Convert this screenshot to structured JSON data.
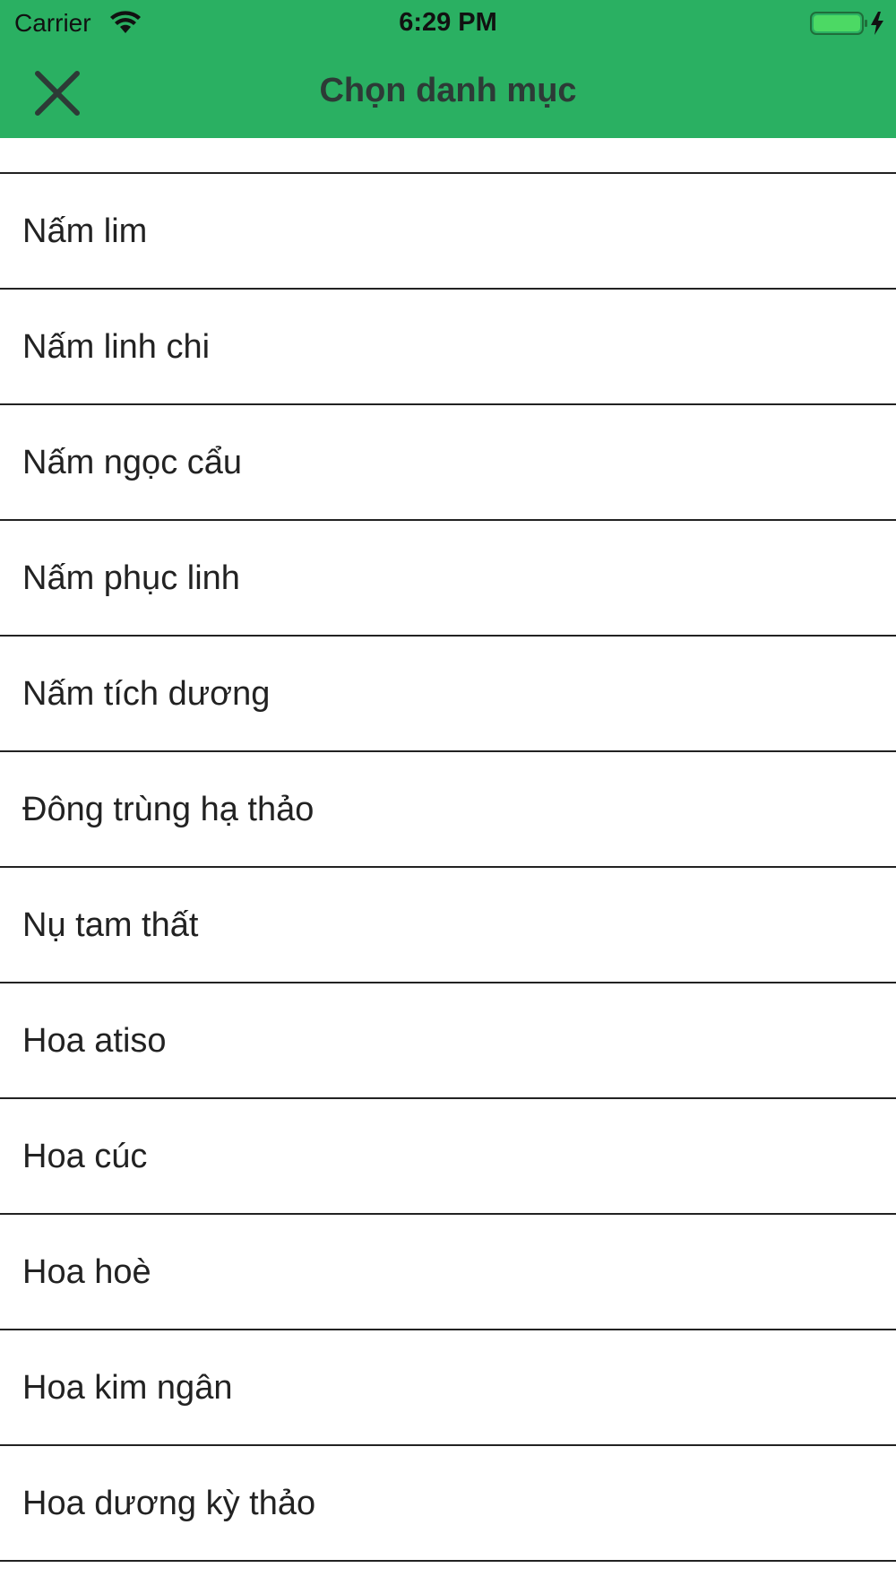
{
  "status_bar": {
    "carrier": "Carrier",
    "time": "6:29 PM",
    "wifi_icon": "wifi-icon",
    "battery_icon": "battery-charging-icon"
  },
  "header": {
    "title": "Chọn danh mục",
    "close_icon": "close-icon",
    "background_color": "#2ab062"
  },
  "categories": [
    {
      "label": "Nấm lim"
    },
    {
      "label": "Nấm linh chi"
    },
    {
      "label": "Nấm ngọc cẩu"
    },
    {
      "label": "Nấm phục linh"
    },
    {
      "label": "Nấm tích dương"
    },
    {
      "label": "Đông trùng hạ thảo"
    },
    {
      "label": "Nụ tam thất"
    },
    {
      "label": "Hoa atiso"
    },
    {
      "label": "Hoa cúc"
    },
    {
      "label": "Hoa hoè"
    },
    {
      "label": "Hoa kim ngân"
    },
    {
      "label": "Hoa dương kỳ thảo"
    }
  ]
}
